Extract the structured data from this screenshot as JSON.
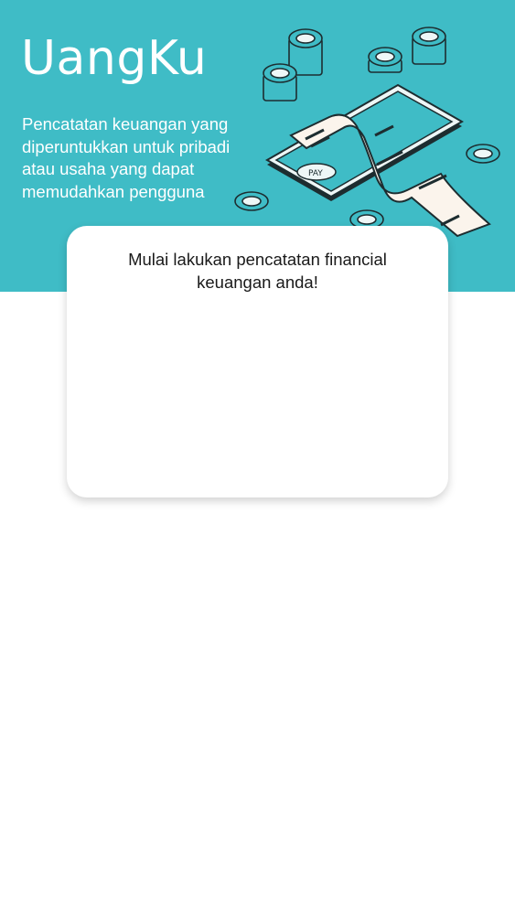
{
  "app": {
    "brand_name": "UangKu",
    "tagline": "Pencatatan keuangan yang diperuntukkan untuk pribadi atau usaha yang dapat memudahkan pengguna"
  },
  "illustration": {
    "icon": "payment-receipt-illustration",
    "pay_label": "PAY"
  },
  "card": {
    "title": "Mulai lakukan pencatatan financial keuangan anda!"
  },
  "colors": {
    "primary": "#3fbcc6",
    "background": "#ffffff",
    "text_dark": "#1a1a1a"
  }
}
